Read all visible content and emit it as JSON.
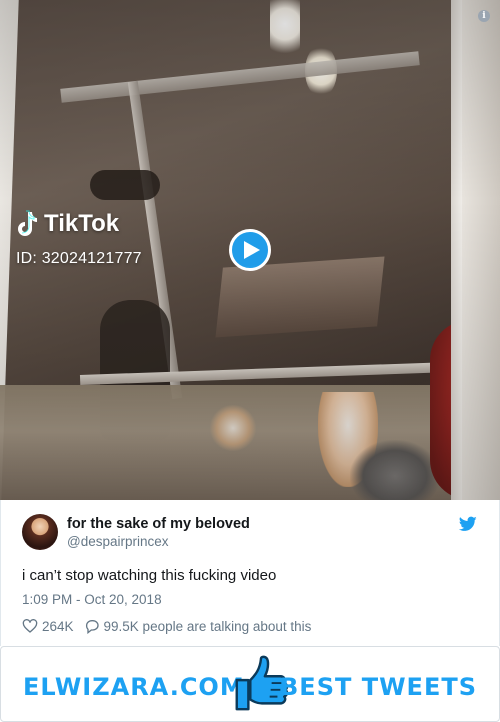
{
  "video": {
    "watermark_brand": "TikTok",
    "watermark_id": "ID: 32024121777",
    "play_icon": "play-icon",
    "info_icon": "info-icon",
    "info_glyph": "i"
  },
  "tweet": {
    "display_name": "for the sake of my beloved",
    "handle": "@despairprincex",
    "text": "i can’t stop watching this fucking video",
    "timestamp": "1:09 PM - Oct 20, 2018",
    "likes": "264K",
    "replies_text": "99.5K people are talking about this",
    "icons": [
      "heart-icon",
      "reply-icon",
      "twitter-bird-icon"
    ]
  },
  "banner": {
    "left_text": "ELWIZARA.COM",
    "right_text": "BEST TWEETS",
    "center_icon": "thumbs-up-icon"
  },
  "colors": {
    "accent": "#1da1f2",
    "text_primary": "#14171a",
    "text_secondary": "#657786"
  }
}
